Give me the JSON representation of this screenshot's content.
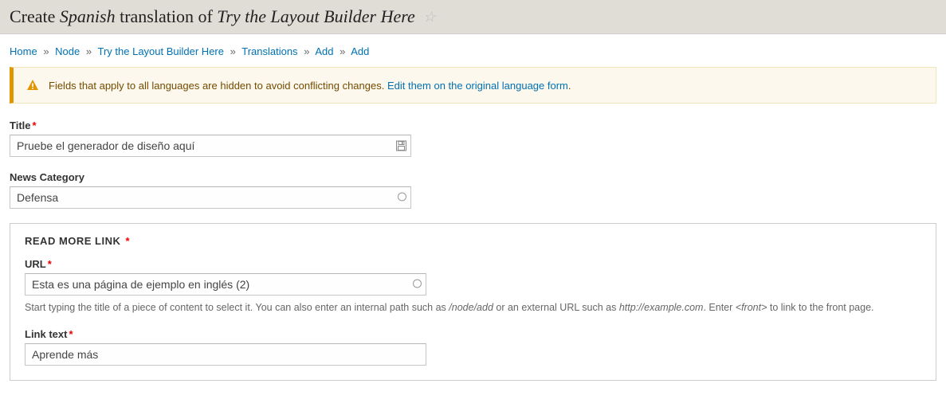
{
  "header": {
    "title_prefix": "Create ",
    "title_lang": "Spanish",
    "title_mid": " translation of ",
    "title_node": "Try the Layout Builder Here"
  },
  "breadcrumb": {
    "items": [
      "Home",
      "Node",
      "Try the Layout Builder Here",
      "Translations",
      "Add",
      "Add"
    ],
    "sep": "»"
  },
  "warning": {
    "text": "Fields that apply to all languages are hidden to avoid conflicting changes. ",
    "link": "Edit them on the original language form",
    "suffix": "."
  },
  "form": {
    "title_label": "Title",
    "title_value": "Pruebe el generador de diseño aquí",
    "category_label": "News Category",
    "category_value": "Defensa",
    "readmore": {
      "legend": "Read more link",
      "url_label": "URL",
      "url_value": "Esta es una página de ejemplo en inglés (2)",
      "url_desc_1": "Start typing the title of a piece of content to select it. You can also enter an internal path such as ",
      "url_desc_ital1": "/node/add",
      "url_desc_2": " or an external URL such as ",
      "url_desc_ital2": "http://example.com",
      "url_desc_3": ". Enter ",
      "url_desc_ital3": "<front>",
      "url_desc_4": " to link to the front page.",
      "linktext_label": "Link text",
      "linktext_value": "Aprende más"
    }
  }
}
